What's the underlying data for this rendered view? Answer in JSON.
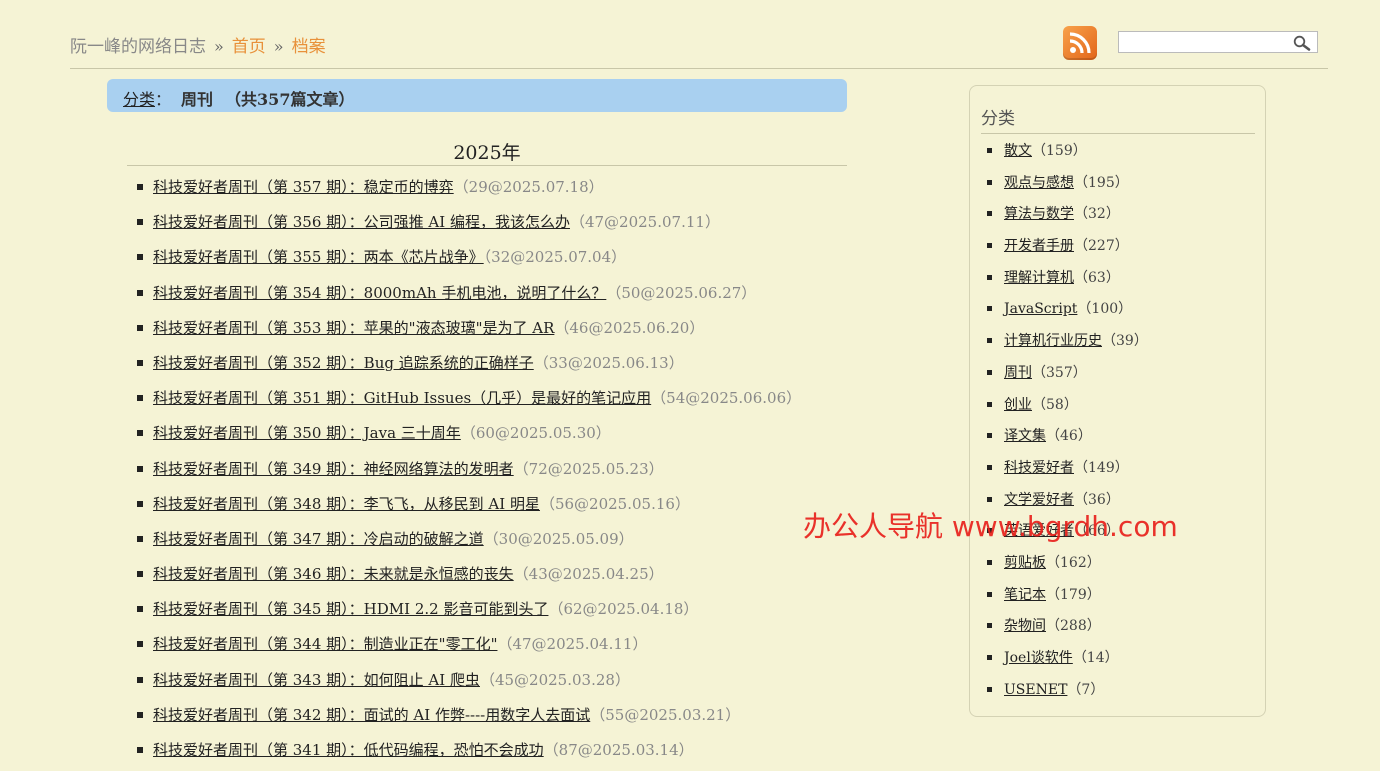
{
  "header": {
    "site_title": "阮一峰的网络日志",
    "separator": "»",
    "breadcrumbs": [
      "首页",
      "档案"
    ],
    "rss_icon": "rss-icon",
    "search": {
      "value": "",
      "placeholder": "",
      "icon": "search-icon"
    }
  },
  "category_bar": {
    "label": "分类",
    "colon": "：",
    "name": "周刊",
    "count_text": "（共357篇文章）"
  },
  "year": "2025年",
  "articles": [
    {
      "title": "科技爱好者周刊（第 357 期）：稳定币的博弈",
      "meta": "（29@2025.07.18）"
    },
    {
      "title": "科技爱好者周刊（第 356 期）：公司强推 AI 编程，我该怎么办",
      "meta": "（47@2025.07.11）"
    },
    {
      "title": "科技爱好者周刊（第 355 期）：两本《芯片战争》",
      "meta": "（32@2025.07.04）"
    },
    {
      "title": "科技爱好者周刊（第 354 期）：8000mAh 手机电池，说明了什么？",
      "meta": "（50@2025.06.27）"
    },
    {
      "title": "科技爱好者周刊（第 353 期）：苹果的\"液态玻璃\"是为了 AR",
      "meta": "（46@2025.06.20）"
    },
    {
      "title": "科技爱好者周刊（第 352 期）：Bug 追踪系统的正确样子",
      "meta": "（33@2025.06.13）"
    },
    {
      "title": "科技爱好者周刊（第 351 期）：GitHub Issues（几乎）是最好的笔记应用",
      "meta": "（54@2025.06.06）"
    },
    {
      "title": "科技爱好者周刊（第 350 期）：Java 三十周年",
      "meta": "（60@2025.05.30）"
    },
    {
      "title": "科技爱好者周刊（第 349 期）：神经网络算法的发明者",
      "meta": "（72@2025.05.23）"
    },
    {
      "title": "科技爱好者周刊（第 348 期）：李飞飞，从移民到 AI 明星",
      "meta": "（56@2025.05.16）"
    },
    {
      "title": "科技爱好者周刊（第 347 期）：冷启动的破解之道",
      "meta": "（30@2025.05.09）"
    },
    {
      "title": "科技爱好者周刊（第 346 期）：未来就是永恒感的丧失",
      "meta": "（43@2025.04.25）"
    },
    {
      "title": "科技爱好者周刊（第 345 期）：HDMI 2.2 影音可能到头了",
      "meta": "（62@2025.04.18）"
    },
    {
      "title": "科技爱好者周刊（第 344 期）：制造业正在\"零工化\"",
      "meta": "（47@2025.04.11）"
    },
    {
      "title": "科技爱好者周刊（第 343 期）：如何阻止 AI 爬虫",
      "meta": "（45@2025.03.28）"
    },
    {
      "title": "科技爱好者周刊（第 342 期）：面试的 AI 作弊----用数字人去面试",
      "meta": "（55@2025.03.21）"
    },
    {
      "title": "科技爱好者周刊（第 341 期）：低代码编程，恐怕不会成功",
      "meta": "（87@2025.03.14）"
    }
  ],
  "sidebar": {
    "title": "分类",
    "categories": [
      {
        "name": "散文",
        "count": "（159）"
      },
      {
        "name": "观点与感想",
        "count": "（195）"
      },
      {
        "name": "算法与数学",
        "count": "（32）"
      },
      {
        "name": "开发者手册",
        "count": "（227）"
      },
      {
        "name": "理解计算机",
        "count": "（63）"
      },
      {
        "name": "JavaScript",
        "count": "（100）"
      },
      {
        "name": "计算机行业历史",
        "count": "（39）"
      },
      {
        "name": "周刊",
        "count": "（357）"
      },
      {
        "name": "创业",
        "count": "（58）"
      },
      {
        "name": "译文集",
        "count": "（46）"
      },
      {
        "name": "科技爱好者",
        "count": "（149）"
      },
      {
        "name": "文学爱好者",
        "count": "（36）"
      },
      {
        "name": "英语爱好者",
        "count": "（66）"
      },
      {
        "name": "剪贴板",
        "count": "（162）"
      },
      {
        "name": "笔记本",
        "count": "（179）"
      },
      {
        "name": "杂物间",
        "count": "（288）"
      },
      {
        "name": "Joel谈软件",
        "count": "（14）"
      },
      {
        "name": "USENET",
        "count": "（7）"
      }
    ]
  },
  "watermark": "办公人导航 www.bgrdh.com"
}
